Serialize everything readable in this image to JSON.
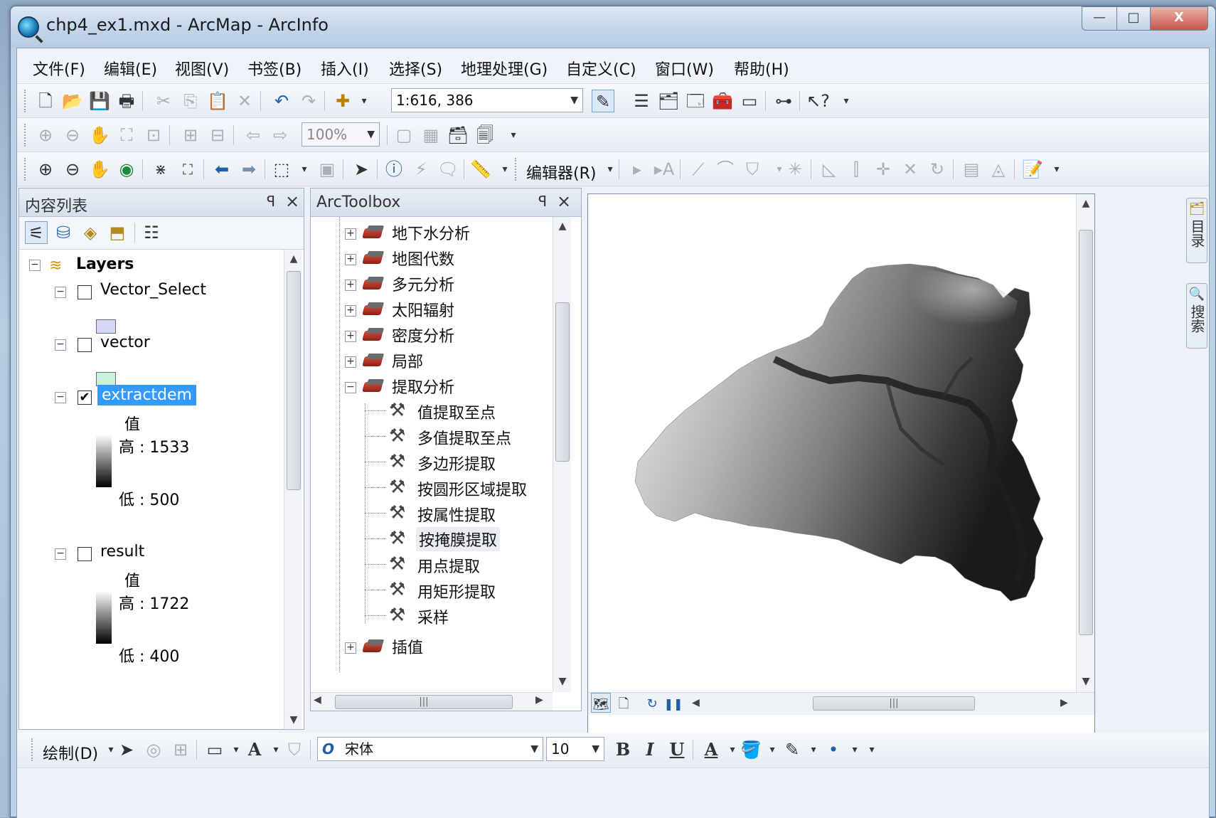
{
  "window": {
    "title": "chp4_ex1.mxd - ArcMap - ArcInfo",
    "controls": {
      "minimize": "—",
      "maximize": "□",
      "close": "X"
    }
  },
  "menu": [
    "文件(F)",
    "编辑(E)",
    "视图(V)",
    "书签(B)",
    "插入(I)",
    "选择(S)",
    "地理处理(G)",
    "自定义(C)",
    "窗口(W)",
    "帮助(H)"
  ],
  "standard_toolbar": {
    "scale": "1:616, 386"
  },
  "layout_toolbar": {
    "zoom": "100%"
  },
  "editor_toolbar": {
    "label": "编辑器(R)"
  },
  "toc": {
    "title": "内容列表",
    "pin": "ꟼ",
    "close": "×",
    "root": "Layers",
    "layers": [
      {
        "name": "Vector_Select",
        "checked": false,
        "swatch_color": "#d5d7f5"
      },
      {
        "name": "vector",
        "checked": false,
        "swatch_color": "#c9f2d8"
      },
      {
        "name": "extractdem",
        "checked": true,
        "legend_title": "值",
        "high": "高 : 1533",
        "low": "低 : 500"
      },
      {
        "name": "result",
        "checked": false,
        "legend_title": "值",
        "high": "高 : 1722",
        "low": "低 : 400"
      }
    ]
  },
  "toolbox": {
    "title": "ArcToolbox",
    "pin": "ꟼ",
    "close": "×",
    "toolsets": [
      "地下水分析",
      "地图代数",
      "多元分析",
      "太阳辐射",
      "密度分析",
      "局部",
      "提取分析"
    ],
    "tools": [
      "值提取至点",
      "多值提取至点",
      "多边形提取",
      "按圆形区域提取",
      "按属性提取",
      "按掩膜提取",
      "用点提取",
      "用矩形提取",
      "采样"
    ],
    "after": "插值"
  },
  "dock": {
    "catalog": "目录",
    "search": "搜索"
  },
  "draw_toolbar": {
    "label": "绘制(D)",
    "font": "宋体",
    "size": "10",
    "bold": "B",
    "italic": "I",
    "underline": "U",
    "font_color": "A"
  },
  "colors": {
    "selection": "#3399ff",
    "title_bar": "#c4d6ea"
  }
}
